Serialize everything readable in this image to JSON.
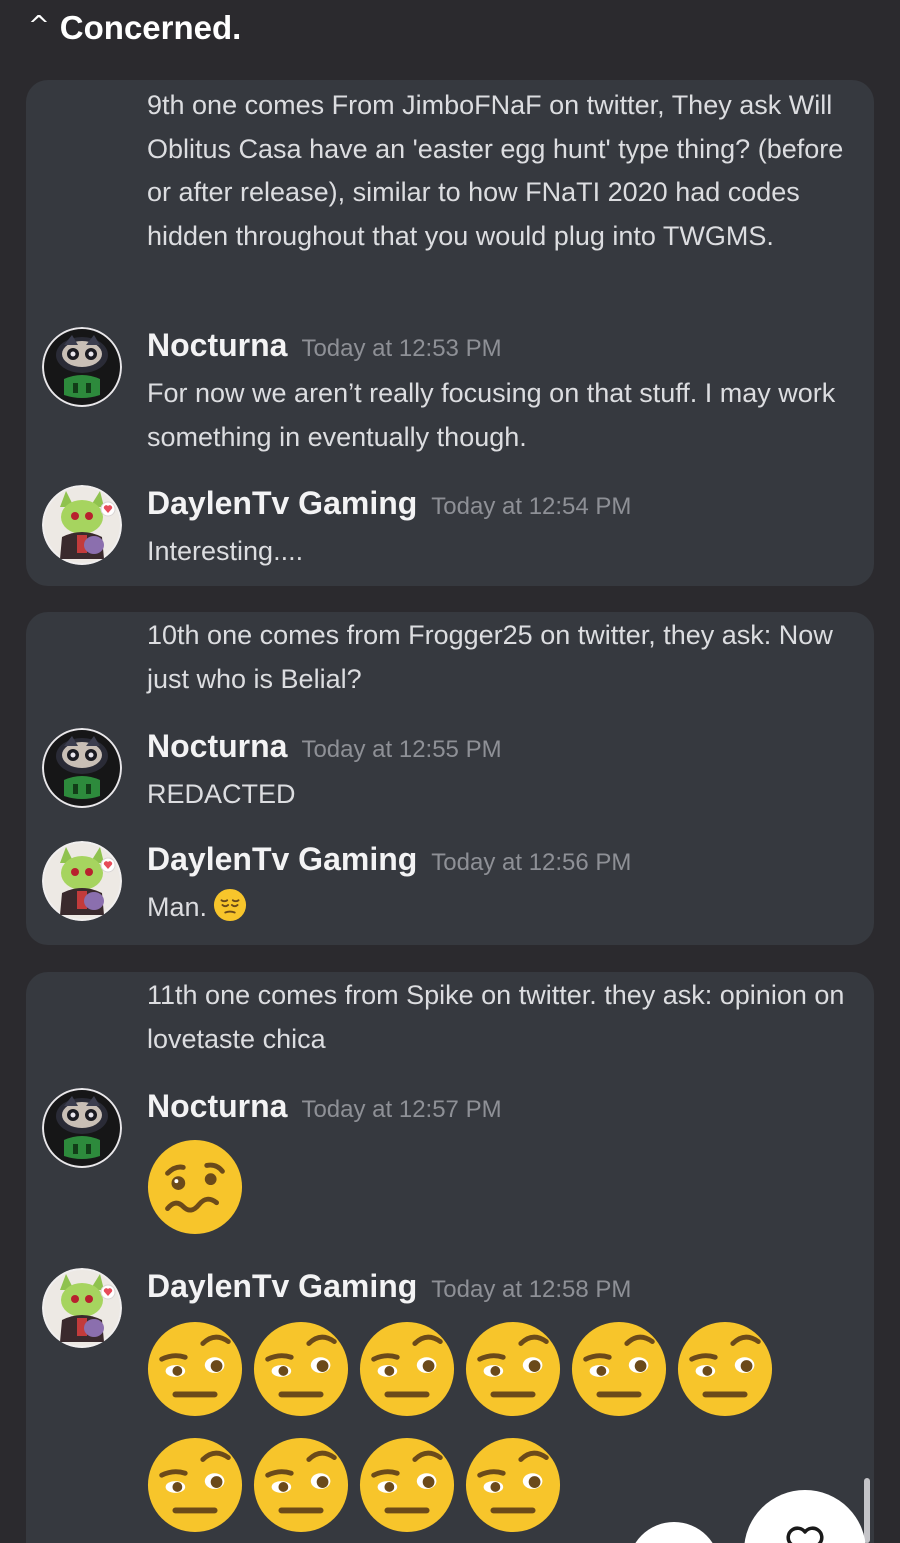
{
  "header": {
    "caret_glyph": "^",
    "title": "Concerned."
  },
  "cards": [
    {
      "question": "9th one comes From JimboFNaF on twitter, They ask Will Oblitus Casa have an 'easter egg hunt' type thing? (before or after release), similar to how FNaTI 2020 had codes hidden throughout that you would plug into TWGMS.",
      "messages": [
        {
          "user": "Nocturna",
          "time": "Today at 12:53 PM",
          "text": "For now we aren’t really focusing on that stuff. I may work something in eventually though."
        },
        {
          "user": "DaylenTv Gaming",
          "time": "Today at 12:54 PM",
          "text": "Interesting...."
        }
      ]
    },
    {
      "question": "10th one comes from Frogger25 on twitter, they ask: Now just who is Belial?",
      "messages": [
        {
          "user": "Nocturna",
          "time": "Today at 12:55 PM",
          "text": "REDACTED"
        },
        {
          "user": "DaylenTv Gaming",
          "time": "Today at 12:56 PM",
          "text": "Man.",
          "emoji": "pensive-face"
        }
      ]
    },
    {
      "question": "11th one comes from Spike on twitter. they ask: opinion on lovetaste chica",
      "messages": [
        {
          "user": "Nocturna",
          "time": "Today at 12:57 PM",
          "emoji": "woozy-face",
          "emoji_count": 1
        },
        {
          "user": "DaylenTv Gaming",
          "time": "Today at 12:58 PM",
          "emoji": "raised-eyebrow-face",
          "emoji_count": 10
        }
      ]
    }
  ],
  "colors": {
    "background": "#2b2a2e",
    "card": "#36393f",
    "emoji_yellow": "#f7c52b",
    "username": "#f3f3f4",
    "timestamp": "#8e9096"
  }
}
